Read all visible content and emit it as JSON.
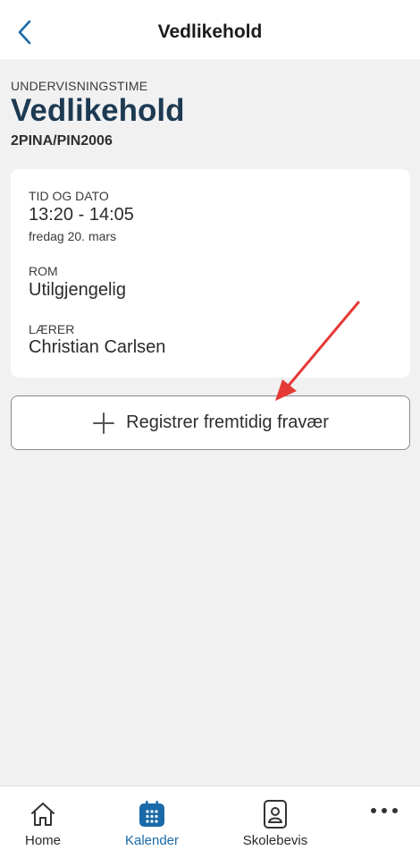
{
  "header": {
    "title": "Vedlikehold",
    "back_icon": "chevron-left-icon"
  },
  "lesson": {
    "kicker": "UNDERVISNINGSTIME",
    "title": "Vedlikehold",
    "code": "2PINA/PIN2006"
  },
  "details": {
    "time_label": "TID OG DATO",
    "time_value": "13:20 - 14:05",
    "date_value": "fredag 20. mars",
    "room_label": "ROM",
    "room_value": "Utilgjengelig",
    "teacher_label": "LÆRER",
    "teacher_value": "Christian Carlsen"
  },
  "actions": {
    "register_label": "Registrer fremtidig fravær",
    "register_icon": "plus-icon"
  },
  "tabbar": {
    "items": [
      {
        "label": "Home",
        "icon": "home-icon",
        "active": false
      },
      {
        "label": "Kalender",
        "icon": "calendar-icon",
        "active": true
      },
      {
        "label": "Skolebevis",
        "icon": "id-card-icon",
        "active": false
      },
      {
        "label": "",
        "icon": "more-icon",
        "active": false
      }
    ]
  },
  "colors": {
    "accent": "#1a6aa8",
    "title": "#1d3a52",
    "annotation_arrow": "#e53935",
    "background": "#f1f1f2"
  }
}
